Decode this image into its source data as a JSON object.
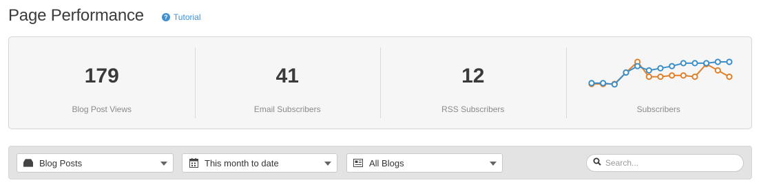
{
  "header": {
    "title": "Page Performance",
    "tutorial_label": "Tutorial",
    "tutorial_icon": "question-circle-icon"
  },
  "stats": [
    {
      "value": "179",
      "label": "Blog Post Views"
    },
    {
      "value": "41",
      "label": "Email Subscribers"
    },
    {
      "value": "12",
      "label": "RSS Subscribers"
    }
  ],
  "sparkline": {
    "label": "Subscribers",
    "colors": {
      "series_a": "#3a8ec9",
      "series_b": "#e07f2a"
    },
    "chart_data": {
      "type": "line",
      "x": [
        1,
        2,
        3,
        4,
        5,
        6,
        7,
        8,
        9,
        10,
        11,
        12,
        13
      ],
      "series": [
        {
          "values": [
            2,
            2,
            1.7,
            4.5,
            6,
            5,
            5.5,
            6,
            6.7,
            6.7,
            6.7,
            7,
            7
          ]
        },
        {
          "values": [
            1.8,
            1.8,
            1.8,
            4.5,
            7,
            3.5,
            3.5,
            3.8,
            3.8,
            3.5,
            6.5,
            5,
            3.5
          ]
        }
      ]
    }
  },
  "toolbar": {
    "content_type": {
      "value": "Blog Posts",
      "icon": "inbox-tray-icon"
    },
    "date_range": {
      "value": "This month to date",
      "icon": "calendar-icon"
    },
    "blog_filter": {
      "value": "All Blogs",
      "icon": "newspaper-icon"
    },
    "search": {
      "placeholder": "Search...",
      "icon": "search-icon"
    }
  }
}
